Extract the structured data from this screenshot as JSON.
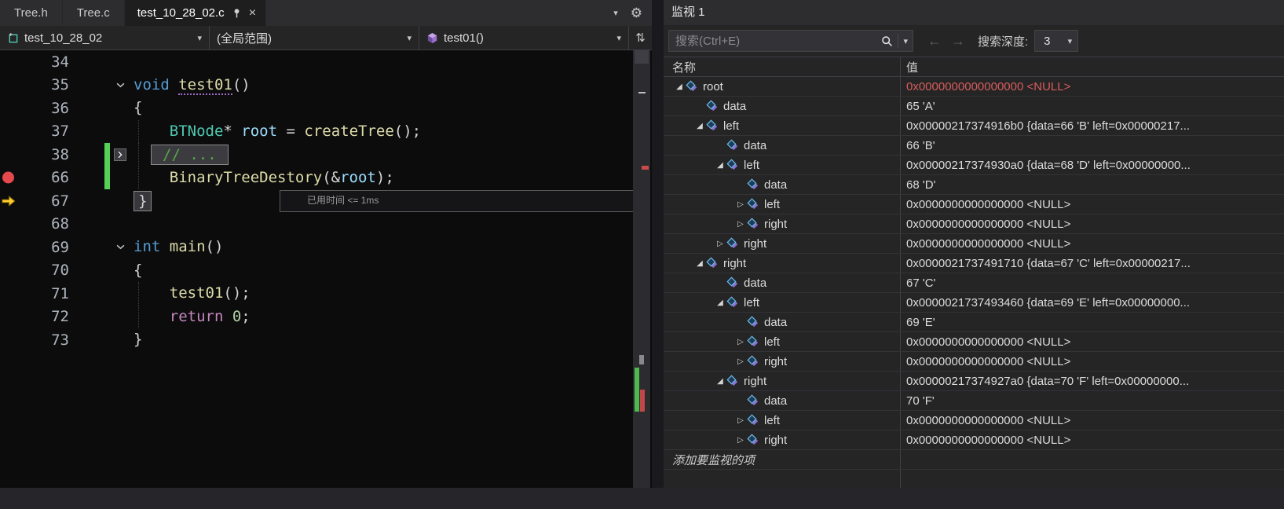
{
  "editor": {
    "tabs": [
      {
        "label": "Tree.h",
        "active": false
      },
      {
        "label": "Tree.c",
        "active": false
      },
      {
        "label": "test_10_28_02.c",
        "active": true
      }
    ],
    "nav": {
      "project": "test_10_28_02",
      "scope": "(全局范围)",
      "member": "test01()"
    },
    "perf_tip": "已用时间 <= 1ms",
    "palette": {
      "keyword": "#569cd6",
      "type": "#4ec9b0",
      "func": "#dcdcaa",
      "var": "#9cdcfe",
      "comment": "#57a64a",
      "text": "#d4d4d4",
      "number": "#b5cea8",
      "control": "#c586c0"
    },
    "lines": [
      {
        "n": 34,
        "tokens": []
      },
      {
        "n": 35,
        "fold": "open",
        "tokens": [
          {
            "k": "keyword",
            "t": "void "
          },
          {
            "k": "func",
            "t": "test01",
            "u": true
          },
          {
            "k": "text",
            "t": "()"
          }
        ]
      },
      {
        "n": 36,
        "tokens": [
          {
            "k": "text",
            "t": "{"
          }
        ]
      },
      {
        "n": 37,
        "guide": true,
        "tokens": [
          {
            "k": "type",
            "t": "    BTNode"
          },
          {
            "k": "text",
            "t": "* "
          },
          {
            "k": "var",
            "t": "root"
          },
          {
            "k": "text",
            "t": " = "
          },
          {
            "k": "func",
            "t": "createTree"
          },
          {
            "k": "text",
            "t": "();"
          }
        ]
      },
      {
        "n": 38,
        "guide": true,
        "changed": true,
        "fold": "closed",
        "box": true,
        "tokens": [
          {
            "k": "comment",
            "t": "// ..."
          }
        ]
      },
      {
        "n": 66,
        "guide": true,
        "changed": true,
        "breakpoint": true,
        "tokens": [
          {
            "k": "func",
            "t": "    BinaryTreeDestory"
          },
          {
            "k": "text",
            "t": "(&"
          },
          {
            "k": "var",
            "t": "root"
          },
          {
            "k": "text",
            "t": ");"
          }
        ]
      },
      {
        "n": 67,
        "arrow": true,
        "current": true,
        "tokens": [
          {
            "k": "text",
            "t": "}",
            "b": true
          }
        ]
      },
      {
        "n": 68,
        "tokens": []
      },
      {
        "n": 69,
        "fold": "open",
        "tokens": [
          {
            "k": "keyword",
            "t": "int "
          },
          {
            "k": "func",
            "t": "main"
          },
          {
            "k": "text",
            "t": "()"
          }
        ]
      },
      {
        "n": 70,
        "tokens": [
          {
            "k": "text",
            "t": "{"
          }
        ]
      },
      {
        "n": 71,
        "guide": true,
        "tokens": [
          {
            "k": "func",
            "t": "    test01"
          },
          {
            "k": "text",
            "t": "();"
          }
        ]
      },
      {
        "n": 72,
        "guide": true,
        "tokens": [
          {
            "k": "control",
            "t": "    return "
          },
          {
            "k": "number",
            "t": "0"
          },
          {
            "k": "text",
            "t": ";"
          }
        ]
      },
      {
        "n": 73,
        "tokens": [
          {
            "k": "text",
            "t": "}"
          }
        ]
      }
    ]
  },
  "watch": {
    "title": "监视 1",
    "search_placeholder": "搜索(Ctrl+E)",
    "back_arrow": "←",
    "forward_arrow": "→",
    "depth_label": "搜索深度:",
    "depth_value": "3",
    "col_name": "名称",
    "col_value": "值",
    "add_row_label": "添加要监视的项",
    "changed_value_color": "#d85c5c",
    "rows": [
      {
        "name": "root",
        "level": 0,
        "glyph": "open",
        "value": "0x0000000000000000 <NULL>",
        "changed": true
      },
      {
        "name": "data",
        "level": 1,
        "glyph": "none",
        "value": "65 'A'"
      },
      {
        "name": "left",
        "level": 1,
        "glyph": "open",
        "value": "0x00000217374916b0 {data=66 'B' left=0x00000217..."
      },
      {
        "name": "data",
        "level": 2,
        "glyph": "none",
        "value": "66 'B'"
      },
      {
        "name": "left",
        "level": 2,
        "glyph": "open",
        "value": "0x00000217374930a0 {data=68 'D' left=0x00000000..."
      },
      {
        "name": "data",
        "level": 3,
        "glyph": "none",
        "value": "68 'D'"
      },
      {
        "name": "left",
        "level": 3,
        "glyph": "closed",
        "value": "0x0000000000000000 <NULL>"
      },
      {
        "name": "right",
        "level": 3,
        "glyph": "closed",
        "value": "0x0000000000000000 <NULL>"
      },
      {
        "name": "right",
        "level": 2,
        "glyph": "closed",
        "value": "0x0000000000000000 <NULL>"
      },
      {
        "name": "right",
        "level": 1,
        "glyph": "open",
        "value": "0x0000021737491710 {data=67 'C' left=0x00000217..."
      },
      {
        "name": "data",
        "level": 2,
        "glyph": "none",
        "value": "67 'C'"
      },
      {
        "name": "left",
        "level": 2,
        "glyph": "open",
        "value": "0x0000021737493460 {data=69 'E' left=0x00000000..."
      },
      {
        "name": "data",
        "level": 3,
        "glyph": "none",
        "value": "69 'E'"
      },
      {
        "name": "left",
        "level": 3,
        "glyph": "closed",
        "value": "0x0000000000000000 <NULL>"
      },
      {
        "name": "right",
        "level": 3,
        "glyph": "closed",
        "value": "0x0000000000000000 <NULL>"
      },
      {
        "name": "right",
        "level": 2,
        "glyph": "open",
        "value": "0x00000217374927a0 {data=70 'F' left=0x00000000..."
      },
      {
        "name": "data",
        "level": 3,
        "glyph": "none",
        "value": "70 'F'"
      },
      {
        "name": "left",
        "level": 3,
        "glyph": "closed",
        "value": "0x0000000000000000 <NULL>"
      },
      {
        "name": "right",
        "level": 3,
        "glyph": "closed",
        "value": "0x0000000000000000 <NULL>"
      }
    ]
  }
}
